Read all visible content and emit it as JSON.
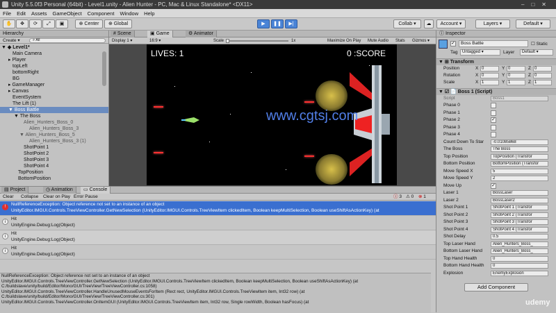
{
  "app": {
    "title": "Unity 5.5.0f3 Personal (64bit) - Level1.unity - Alien Hunter - PC, Mac & Linux Standalone* <DX11>"
  },
  "menu": [
    "File",
    "Edit",
    "Assets",
    "GameObject",
    "Component",
    "Window",
    "Help"
  ],
  "toolbar": {
    "pivot": "Center",
    "space": "Global",
    "collab": "Collab",
    "account": "Account",
    "layers": "Layers",
    "layout": "Default"
  },
  "hierarchy": {
    "tab": "Hierarchy",
    "create": "Create",
    "search_placeholder": "All",
    "scene": "Level1*",
    "items": [
      "Main Camera",
      "Player",
      "topLeft",
      "bottomRight",
      "BG",
      "GameManager",
      "Canvas",
      "EventSystem",
      "The Lift (1)",
      "Boss Battle",
      "The Boss",
      "Alien_Hunters_Boss_0",
      "Alien_Hunters_Boss_3",
      "Alien_Hunters_Boss_5",
      "Alien_Hunters_Boss_3 (1)",
      "ShotPoint 1",
      "ShotPoint 2",
      "ShotPoint 3",
      "ShotPoint 4",
      "TopPosition",
      "BottomPosition"
    ]
  },
  "scene_tabs": [
    "Scene",
    "Game",
    "Animator"
  ],
  "gamebar": {
    "display": "Display 1",
    "aspect": "16:9",
    "scale_label": "Scale",
    "scale_value": "1x",
    "maximize": "Maximize On Play",
    "mute": "Mute Audio",
    "stats": "Stats",
    "gizmos": "Gizmos"
  },
  "game": {
    "lives": "LIVES: 1",
    "score": "0 :SCORE",
    "watermark": "www.cgtsj.com"
  },
  "bottom_tabs": [
    "Project",
    "Animation",
    "Console"
  ],
  "console": {
    "buttons": [
      "Clear",
      "Collapse",
      "Clear on Play",
      "Error Pause"
    ],
    "counts": {
      "warn": "3",
      "log": "0",
      "err": "1"
    },
    "rows": [
      {
        "type": "err",
        "line1": "NullReferenceException: Object reference not set to an instance of an object",
        "line2": "UnityEditor.IMGUI.Controls.TreeViewController.GetNewSelection (UnityEditor.IMGUI.Controls.TreeViewItem clickedItem, Boolean keepMultiSelection, Boolean useShiftAsActionKey) (at"
      },
      {
        "type": "log",
        "line1": "Hit",
        "line2": "UnityEngine.Debug:Log(Object)"
      },
      {
        "type": "log",
        "line1": "Hit",
        "line2": "UnityEngine.Debug:Log(Object)"
      },
      {
        "type": "log",
        "line1": "Hit",
        "line2": "UnityEngine.Debug:Log(Object)"
      }
    ],
    "stack": [
      "NullReferenceException: Object reference not set to an instance of an object",
      "UnityEditor.IMGUI.Controls.TreeViewController.GetNewSelection (UnityEditor.IMGUI.Controls.TreeViewItem clickedItem, Boolean keepMultiSelection, Boolean useShiftAsActionKey) (at",
      "C:/buildslave/unity/build/Editor/Mono/GUI/TreeView/TreeViewController.cs:1058)",
      "UnityEditor.IMGUI.Controls.TreeViewController.HandleUnusedMouseEventsForItem (Rect rect, UnityEditor.IMGUI.Controls.TreeViewItem item, Int32 row) (at",
      "C:/buildslave/unity/build/Editor/Mono/GUI/TreeView/TreeViewController.cs:301)",
      "UnityEditor.IMGUI.Controls.TreeViewController.OnItemGUI (UnityEditor.IMGUI.Controls.TreeViewItem item, Int32 row, Single rowWidth, Boolean hasFocus) (at"
    ]
  },
  "inspector": {
    "tab": "Inspector",
    "object_name": "Boss Battle",
    "static": "Static",
    "tag_label": "Tag",
    "tag_value": "Untagged",
    "layer_label": "Layer",
    "layer_value": "Default",
    "transform": {
      "title": "Transform",
      "rows": [
        {
          "label": "Position",
          "x": "0",
          "y": "0",
          "z": "0"
        },
        {
          "label": "Rotation",
          "x": "0",
          "y": "0",
          "z": "0"
        },
        {
          "label": "Scale",
          "x": "1",
          "y": "1",
          "z": "1"
        }
      ]
    },
    "script": {
      "title": "Boss 1 (Script)",
      "script_label": "Script",
      "script_value": "Boss1",
      "fields": [
        {
          "label": "Phase 0",
          "kind": "check",
          "value": ""
        },
        {
          "label": "Phase 1",
          "kind": "check",
          "value": ""
        },
        {
          "label": "Phase 2",
          "kind": "check",
          "value": "✓"
        },
        {
          "label": "Phase 3",
          "kind": "check",
          "value": ""
        },
        {
          "label": "Phase 4",
          "kind": "check",
          "value": ""
        },
        {
          "label": "Count Down To Star",
          "kind": "text",
          "value": "-0.01085868"
        },
        {
          "label": "The Boss",
          "kind": "text",
          "value": "The Boss"
        },
        {
          "label": "Top Position",
          "kind": "text",
          "value": "TopPosition (Transfor"
        },
        {
          "label": "Bottom Position",
          "kind": "text",
          "value": "BottomPosition (Transfor"
        },
        {
          "label": "Move Speed X",
          "kind": "text",
          "value": "5"
        },
        {
          "label": "Move Speed Y",
          "kind": "text",
          "value": "2"
        },
        {
          "label": "Move Up",
          "kind": "check",
          "value": "✓"
        },
        {
          "label": "Laser 1",
          "kind": "text",
          "value": "BossLaser"
        },
        {
          "label": "Laser 2",
          "kind": "text",
          "value": "BossLaser2"
        },
        {
          "label": "Shot Point 1",
          "kind": "text",
          "value": "ShotPoint 1 (Transfor"
        },
        {
          "label": "Shot Point 2",
          "kind": "text",
          "value": "ShotPoint 2 (Transfor"
        },
        {
          "label": "Shot Point 3",
          "kind": "text",
          "value": "ShotPoint 3 (Transfor"
        },
        {
          "label": "Shot Point 4",
          "kind": "text",
          "value": "ShotPoint 4 (Transfor"
        },
        {
          "label": "Shot Delay",
          "kind": "text",
          "value": "0.5"
        },
        {
          "label": "Top Laser Hand",
          "kind": "text",
          "value": "Alien_Hunters_Boss_"
        },
        {
          "label": "Bottom Laser Hand",
          "kind": "text",
          "value": "Alien_Hunters_Boss_"
        },
        {
          "label": "Top Hand Health",
          "kind": "text",
          "value": "0"
        },
        {
          "label": "Bottom Hand Health",
          "kind": "text",
          "value": "0"
        },
        {
          "label": "Explosion",
          "kind": "text",
          "value": "EnemyExplosion"
        }
      ]
    },
    "add_component": "Add Component"
  },
  "udemy": "udemy"
}
